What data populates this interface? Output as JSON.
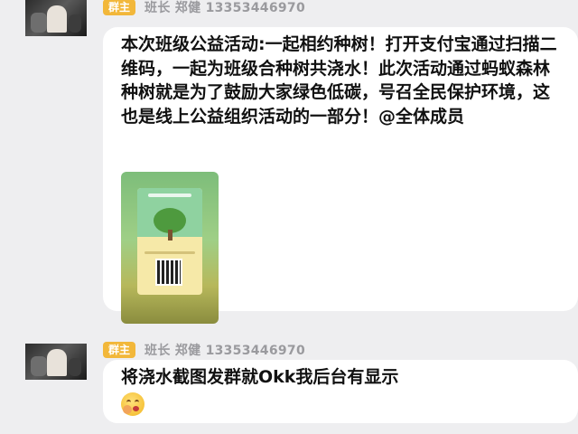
{
  "messages": [
    {
      "badge": "群主",
      "sender": "班长 郑健 13353446970",
      "text": "本次班级公益活动:一起相约种树！打开支付宝通过扫描二维码，一起为班级合种树共浇水！此次活动通过蚂蚁森林种树就是为了鼓励大家绿色低碳，号召全民保护环境，这也是线上公益组织活动的一部分！@全体成员",
      "image": "tree-planting-qr-image"
    },
    {
      "badge": "群主",
      "sender": "班长 郑健 13353446970",
      "text": "将浇水截图发群就Okk我后台有显示",
      "emoji": "covering-mouth-emoji"
    }
  ]
}
